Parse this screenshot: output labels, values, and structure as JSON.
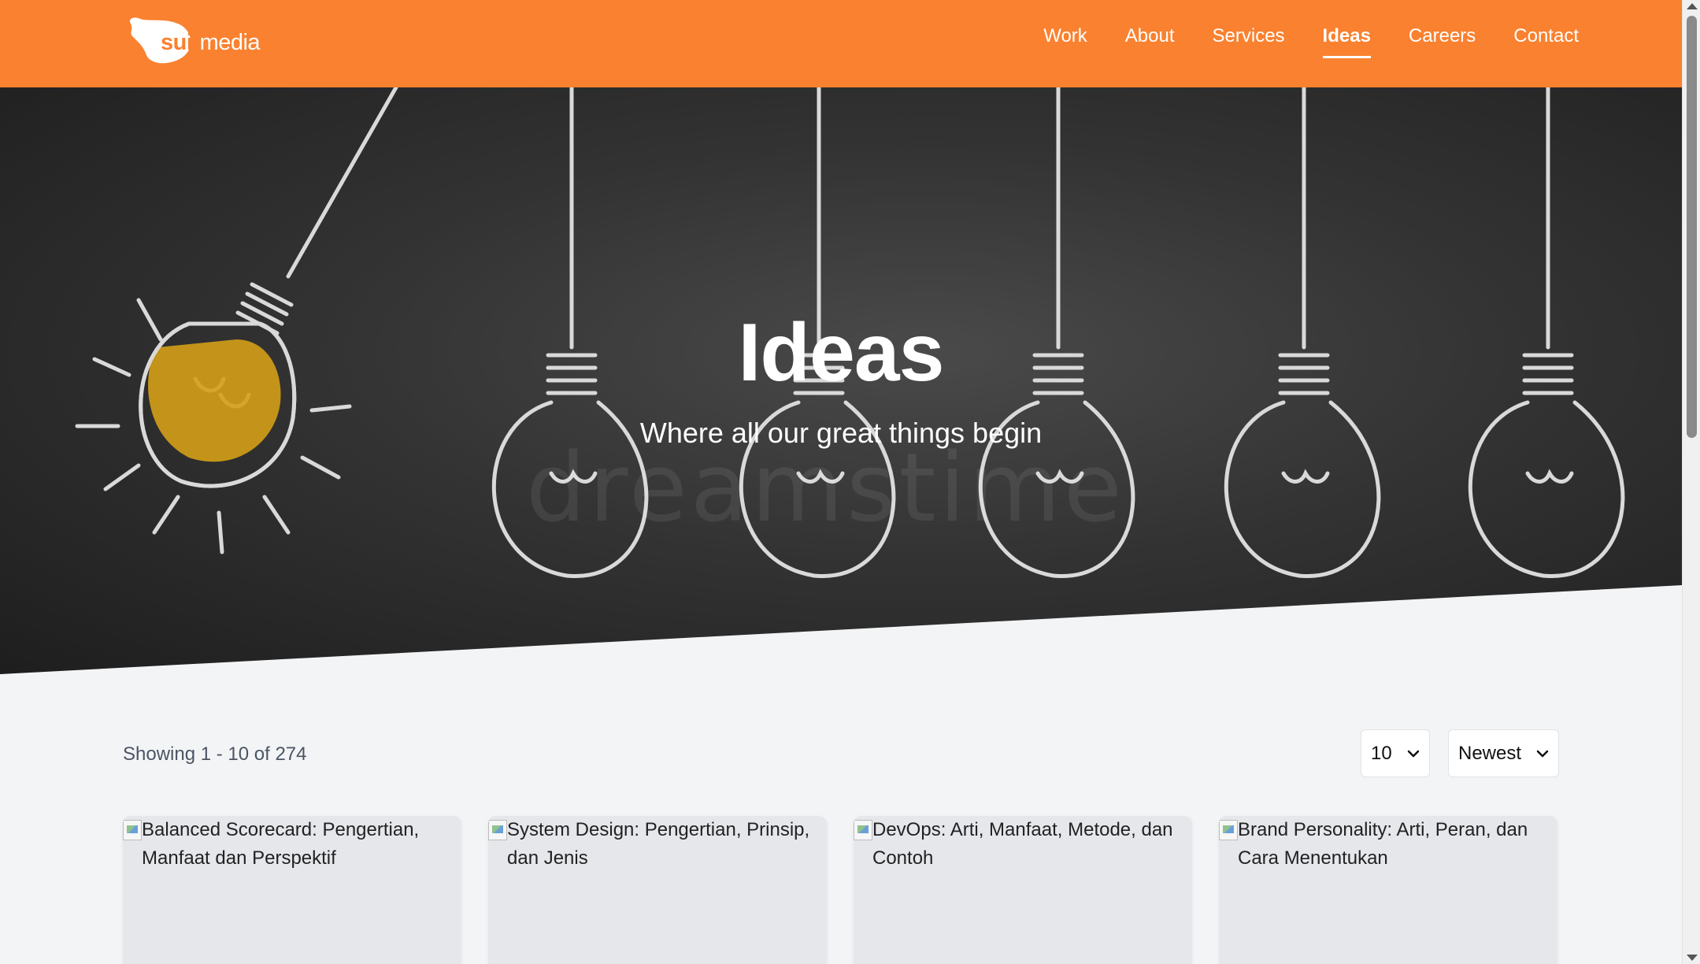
{
  "brand": {
    "logo_bold": "suit",
    "logo_rest": "media"
  },
  "nav": {
    "items": [
      {
        "label": "Work"
      },
      {
        "label": "About"
      },
      {
        "label": "Services"
      },
      {
        "label": "Ideas",
        "active": true
      },
      {
        "label": "Careers"
      },
      {
        "label": "Contact"
      }
    ]
  },
  "hero": {
    "title": "Ideas",
    "subtitle": "Where all our great things begin",
    "watermark": "dreamstime"
  },
  "listing": {
    "showing_text": "Showing 1 - 10 of 274",
    "per_page_value": "10",
    "sort_value": "Newest"
  },
  "cards": [
    {
      "alt": "Balanced Scorecard: Pengertian, Manfaat dan Perspektif"
    },
    {
      "alt": "System Design: Pengertian, Prinsip, dan Jenis"
    },
    {
      "alt": "DevOps: Arti, Manfaat, Metode, dan Contoh"
    },
    {
      "alt": "Brand Personality: Arti, Peran, dan Cara Menentukan"
    }
  ],
  "colors": {
    "header_bg": "#fa812f",
    "page_bg": "#f3f4f6",
    "bulb_yellow": "#d4a017"
  }
}
